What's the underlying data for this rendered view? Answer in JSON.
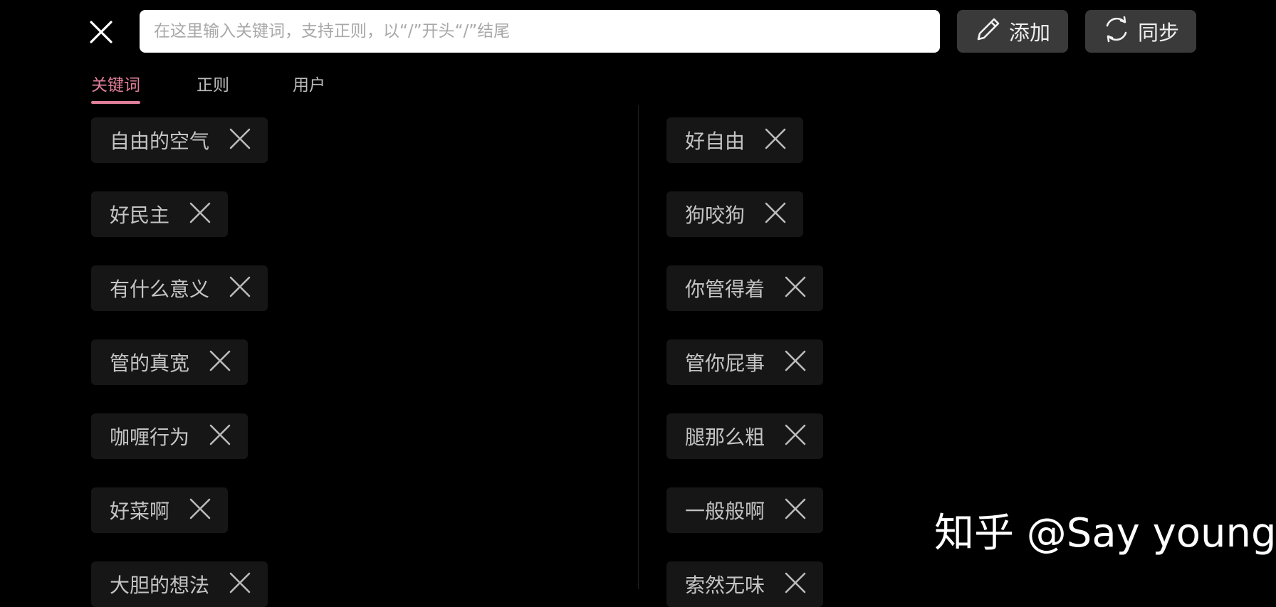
{
  "icons": {
    "close": "close-icon",
    "edit": "pencil-icon",
    "sync": "sync-icon",
    "remove": "x-icon"
  },
  "colors": {
    "background": "#000000",
    "accent": "#e07f99",
    "chip_bg": "#161616",
    "button_bg": "#3a3a3a"
  },
  "search": {
    "value": "",
    "placeholder": "在这里输入关键词，支持正则，以“/”开头“/”结尾"
  },
  "buttons": {
    "add_label": "添加",
    "sync_label": "同步"
  },
  "tabs": [
    {
      "label": "关键词",
      "active": true
    },
    {
      "label": "正则",
      "active": false
    },
    {
      "label": "用户",
      "active": false
    }
  ],
  "keywords": {
    "left": [
      "自由的空气",
      "好民主",
      "有什么意义",
      "管的真宽",
      "咖喱行为",
      "好菜啊",
      "大胆的想法"
    ],
    "right": [
      "好自由",
      "狗咬狗",
      "你管得着",
      "管你屁事",
      "腿那么粗",
      "一般般啊",
      "索然无味"
    ]
  },
  "watermark": "知乎 @Say young"
}
